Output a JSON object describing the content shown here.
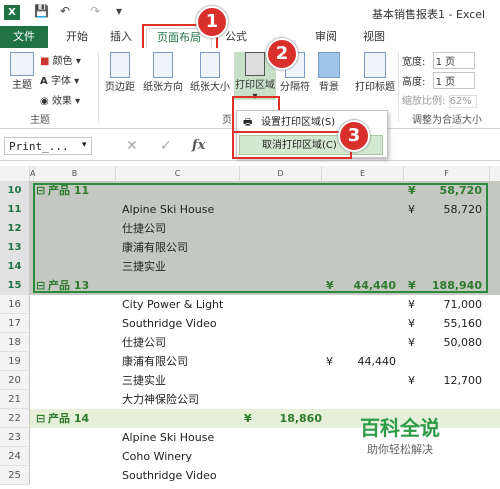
{
  "window": {
    "title": "基本销售报表1 - Excel",
    "app_icon": "X"
  },
  "tabs": [
    "文件",
    "开始",
    "插入",
    "页面布局",
    "公式",
    "审阅",
    "视图"
  ],
  "ribbon": {
    "theme": {
      "label": "主题",
      "colors": "颜色",
      "fonts": "字体",
      "effects": "效果"
    },
    "page_setup": {
      "margins": "页边距",
      "orientation": "纸张方向",
      "size": "纸张大小",
      "print_area": "打印区域",
      "breaks": "分隔符",
      "background": "背景",
      "print_titles": "打印标题"
    },
    "group_theme": "主题",
    "group_page": "页",
    "scale": {
      "width_label": "宽度:",
      "width_value": "1 页",
      "height_label": "高度:",
      "height_value": "1 页",
      "zoom_label": "缩放比例:",
      "zoom_value": "62%",
      "group_label": "调整为合适大小"
    }
  },
  "dropdown": {
    "set_print_area": "设置打印区域(S)",
    "clear_print_area": "取消打印区域(C)"
  },
  "formula_bar": {
    "name_box": "Print_...",
    "fx": "fx"
  },
  "columns": [
    "A",
    "B",
    "C",
    "D",
    "E",
    "F"
  ],
  "rows": [
    {
      "num": "10",
      "b": "产品 11",
      "c": "",
      "d": "",
      "e": "",
      "f_sym": "¥",
      "f": "58,720"
    },
    {
      "num": "11",
      "b": "",
      "c": "Alpine Ski House",
      "d": "",
      "e": "",
      "f_sym": "¥",
      "f": "58,720"
    },
    {
      "num": "12",
      "b": "",
      "c": "仕捷公司",
      "d": "",
      "e": "",
      "f_sym": "",
      "f": ""
    },
    {
      "num": "13",
      "b": "",
      "c": "康浦有限公司",
      "d": "",
      "e": "",
      "f_sym": "",
      "f": ""
    },
    {
      "num": "14",
      "b": "",
      "c": "三捷实业",
      "d": "",
      "e": "",
      "f_sym": "",
      "f": ""
    },
    {
      "num": "15",
      "b": "产品 13",
      "c": "",
      "d": "¥",
      "e": "44,440",
      "f_sym": "¥",
      "f": "188,940"
    },
    {
      "num": "16",
      "b": "",
      "c": "City Power & Light",
      "d": "",
      "e": "",
      "f_sym": "¥",
      "f": "71,000"
    },
    {
      "num": "17",
      "b": "",
      "c": "Southridge Video",
      "d": "",
      "e": "",
      "f_sym": "¥",
      "f": "55,160"
    },
    {
      "num": "18",
      "b": "",
      "c": "仕捷公司",
      "d": "",
      "e": "",
      "f_sym": "¥",
      "f": "50,080"
    },
    {
      "num": "19",
      "b": "",
      "c": "康浦有限公司",
      "d": "¥",
      "e": "44,440",
      "f_sym": "",
      "f": ""
    },
    {
      "num": "20",
      "b": "",
      "c": "三捷实业",
      "d": "",
      "e": "",
      "f_sym": "¥",
      "f": "12,700"
    },
    {
      "num": "21",
      "b": "",
      "c": "大力神保险公司",
      "d": "",
      "e": "",
      "f_sym": "",
      "f": ""
    },
    {
      "num": "22",
      "b": "产品 14",
      "c": "¥",
      "d": "18,860",
      "e": "",
      "f_sym": "",
      "f": ""
    },
    {
      "num": "23",
      "b": "",
      "c": "Alpine Ski House",
      "d": "",
      "e": "",
      "f_sym": "",
      "f": ""
    },
    {
      "num": "24",
      "b": "",
      "c": "Coho Winery",
      "d": "",
      "e": "",
      "f_sym": "",
      "f": ""
    },
    {
      "num": "25",
      "b": "",
      "c": "Southridge Video",
      "d": "",
      "e": "",
      "f_sym": "",
      "f": ""
    }
  ],
  "annotations": [
    "1",
    "2",
    "3"
  ],
  "watermark": {
    "title": "百科全说",
    "subtitle": "助你轻松解决"
  },
  "colors": {
    "excel_green": "#217346",
    "highlight_red": "#e0302a",
    "print_area_border": "#2b8a3e"
  }
}
